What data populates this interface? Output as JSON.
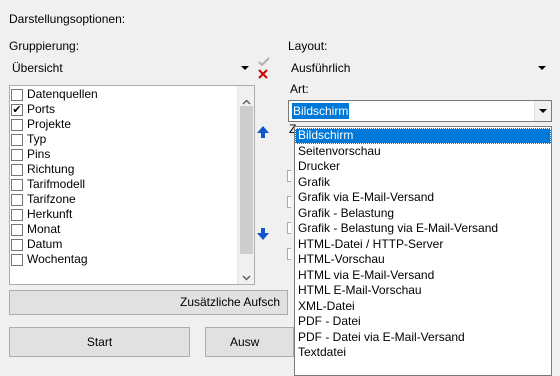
{
  "panel": {
    "title": "Darstellungsoptionen:"
  },
  "grouping": {
    "label": "Gruppierung:",
    "selected": "Übersicht",
    "items": [
      {
        "label": "Datenquellen",
        "checked": false
      },
      {
        "label": "Ports",
        "checked": true
      },
      {
        "label": "Projekte",
        "checked": false
      },
      {
        "label": "Typ",
        "checked": false
      },
      {
        "label": "Pins",
        "checked": false
      },
      {
        "label": "Richtung",
        "checked": false
      },
      {
        "label": "Tarifmodell",
        "checked": false
      },
      {
        "label": "Tarifzone",
        "checked": false
      },
      {
        "label": "Herkunft",
        "checked": false
      },
      {
        "label": "Monat",
        "checked": false
      },
      {
        "label": "Datum",
        "checked": false
      },
      {
        "label": "Wochentag",
        "checked": false
      }
    ]
  },
  "layout": {
    "label": "Layout:",
    "selected": "Ausführlich"
  },
  "art": {
    "label": "Art:",
    "selected": "Bildschirm",
    "options": [
      "Bildschirm",
      "Seitenvorschau",
      "Drucker",
      "Grafik",
      "Grafik via E-Mail-Versand",
      "Grafik - Belastung",
      "Grafik - Belastung via E-Mail-Versand",
      "HTML-Datei / HTTP-Server",
      "HTML-Vorschau",
      "HTML via E-Mail-Versand",
      "HTML E-Mail-Vorschau",
      "XML-Datei",
      "PDF - Datei",
      "PDF - Datei via E-Mail-Versand",
      "Textdatei"
    ]
  },
  "buttons": {
    "extra": "Zusätzliche Aufsch",
    "start": "Start",
    "export": "Ausw"
  },
  "colors": {
    "selection": "#0078d7",
    "arrow": "#1155cc",
    "delete": "#cc0000"
  }
}
